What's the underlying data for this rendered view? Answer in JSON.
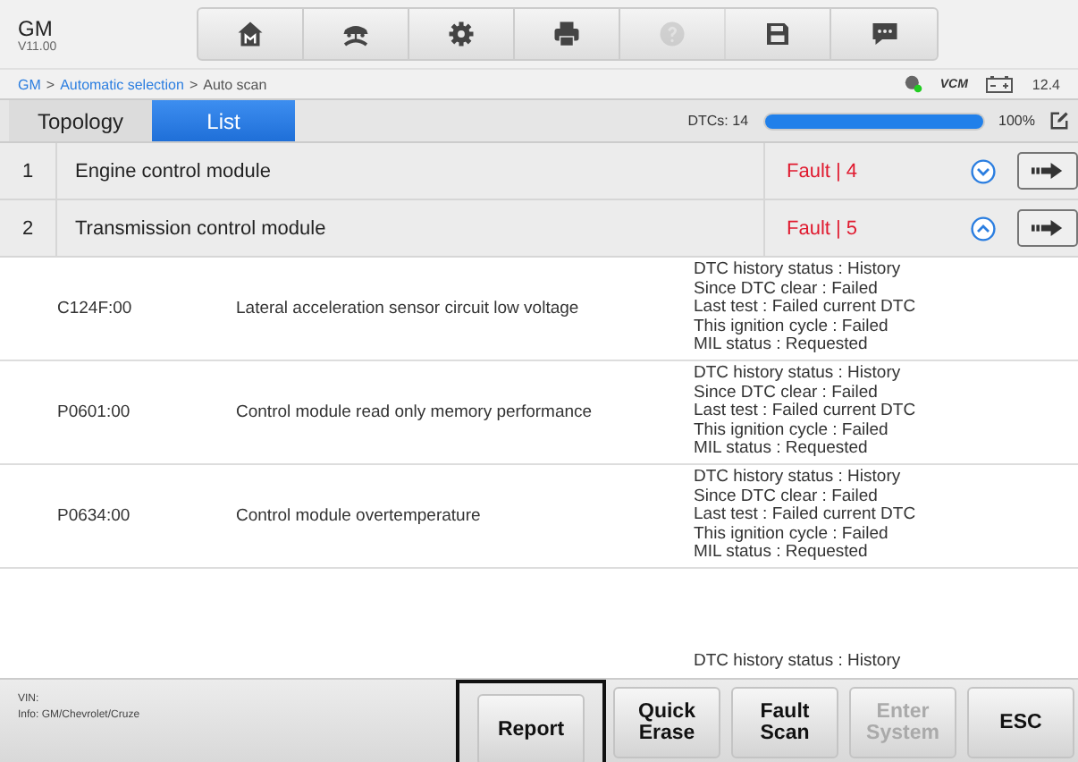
{
  "app": {
    "title": "GM",
    "version": "V11.00"
  },
  "toolbar": [
    {
      "kind": "home",
      "disabled": false
    },
    {
      "kind": "vehicle",
      "disabled": false
    },
    {
      "kind": "settings",
      "disabled": false
    },
    {
      "kind": "print",
      "disabled": false
    },
    {
      "kind": "help",
      "disabled": true
    },
    {
      "kind": "save",
      "disabled": false
    },
    {
      "kind": "message",
      "disabled": false
    }
  ],
  "breadcrumb": {
    "links": [
      "GM",
      "Automatic selection"
    ],
    "separator": ">",
    "current": "Auto scan"
  },
  "status": {
    "vcm": "VCM",
    "voltage": "12.4"
  },
  "tabs": [
    {
      "label": "Topology",
      "selected": false
    },
    {
      "label": "List",
      "selected": true
    }
  ],
  "scan": {
    "dtcs": "DTCs: 14",
    "level": 1,
    "percent": "100%"
  },
  "modules": [
    {
      "number": "1",
      "name": "Engine control module",
      "fault": "Fault | 4",
      "expanded": false
    },
    {
      "number": "2",
      "name": "Transmission control module",
      "fault": "Fault | 5",
      "expanded": true
    }
  ],
  "dtcs": [
    {
      "code": "C124F:00",
      "description": "Lateral acceleration sensor circuit low voltage",
      "status": [
        "DTC history status : History",
        "Since DTC clear : Failed",
        "Last test : Failed current DTC",
        "This ignition cycle : Failed",
        "MIL status : Requested"
      ]
    },
    {
      "code": "P0601:00",
      "description": "Control module read only memory performance",
      "status": [
        "DTC history status : History",
        "Since DTC clear : Failed",
        "Last test : Failed current DTC",
        "This ignition cycle : Failed",
        "MIL status : Requested"
      ]
    },
    {
      "code": "P0634:00",
      "description": "Control module overtemperature",
      "status": [
        "DTC history status : History",
        "Since DTC clear : Failed",
        "Last test : Failed current DTC",
        "This ignition cycle : Failed",
        "MIL status : Requested"
      ]
    },
    {
      "status": [
        "DTC history status : History"
      ]
    }
  ],
  "footer": {
    "vin": "VIN:",
    "info": "Info: GM/Chevrolet/Cruze"
  },
  "buttons": [
    {
      "label": "Report",
      "selected": true,
      "disabled": false
    },
    {
      "label": "Quick Erase",
      "selected": false,
      "disabled": false
    },
    {
      "label": "Fault Scan",
      "selected": false,
      "disabled": false
    },
    {
      "label": "Enter System",
      "selected": false,
      "disabled": true
    },
    {
      "label": "ESC",
      "selected": false,
      "disabled": false
    }
  ]
}
